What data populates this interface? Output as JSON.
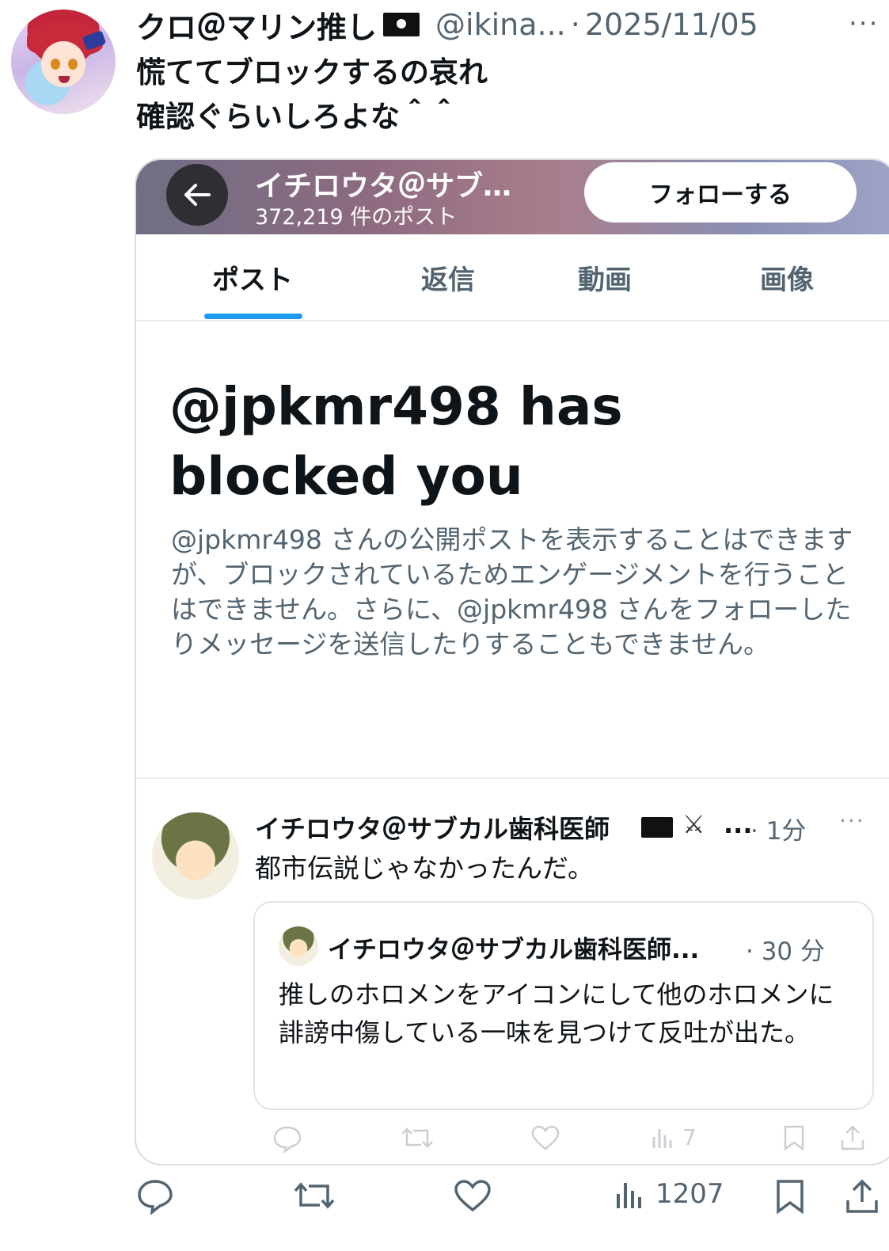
{
  "tweet": {
    "display_name": "クロ＠マリン推し",
    "handle": "@ikina...",
    "separator": "·",
    "date": "2025/11/05",
    "more": "···",
    "text": "慌ててブロックするの哀れ\n確認ぐらいしろよな＾＾",
    "views": "1207"
  },
  "embedded": {
    "header": {
      "back_icon": "←",
      "profile_name": "イチロウタ＠サブ…",
      "post_count": "372,219 件のポスト",
      "follow_label": "フォローする"
    },
    "tabs": [
      "ポスト",
      "返信",
      "動画",
      "画像"
    ],
    "active_tab": 0,
    "blocked": {
      "title": "@jpkmr498 has blocked you",
      "description": "@jpkmr498 さんの公開ポストを表示することはできますが、ブロックされているためエンゲージメントを行うことはできません。さらに、@jpkmr498 さんをフォローしたりメッセージを送信したりすることもできません。"
    },
    "post": {
      "name": "イチロウタ＠サブカル歯科医師",
      "ellipsis": "...",
      "time": "· 1分",
      "more": "···",
      "text": "都市伝説じゃなかったんだ。",
      "views": "7",
      "quote": {
        "name": "イチロウタ＠サブカル歯科医師...",
        "time": "· 30 分",
        "text": "推しのホロメンをアイコンにして他のホロメンに誹謗中傷している一味を見つけて反吐が出た。"
      }
    }
  },
  "colors": {
    "accent": "#1d9bf0",
    "muted": "#536471",
    "text": "#0f1419"
  }
}
